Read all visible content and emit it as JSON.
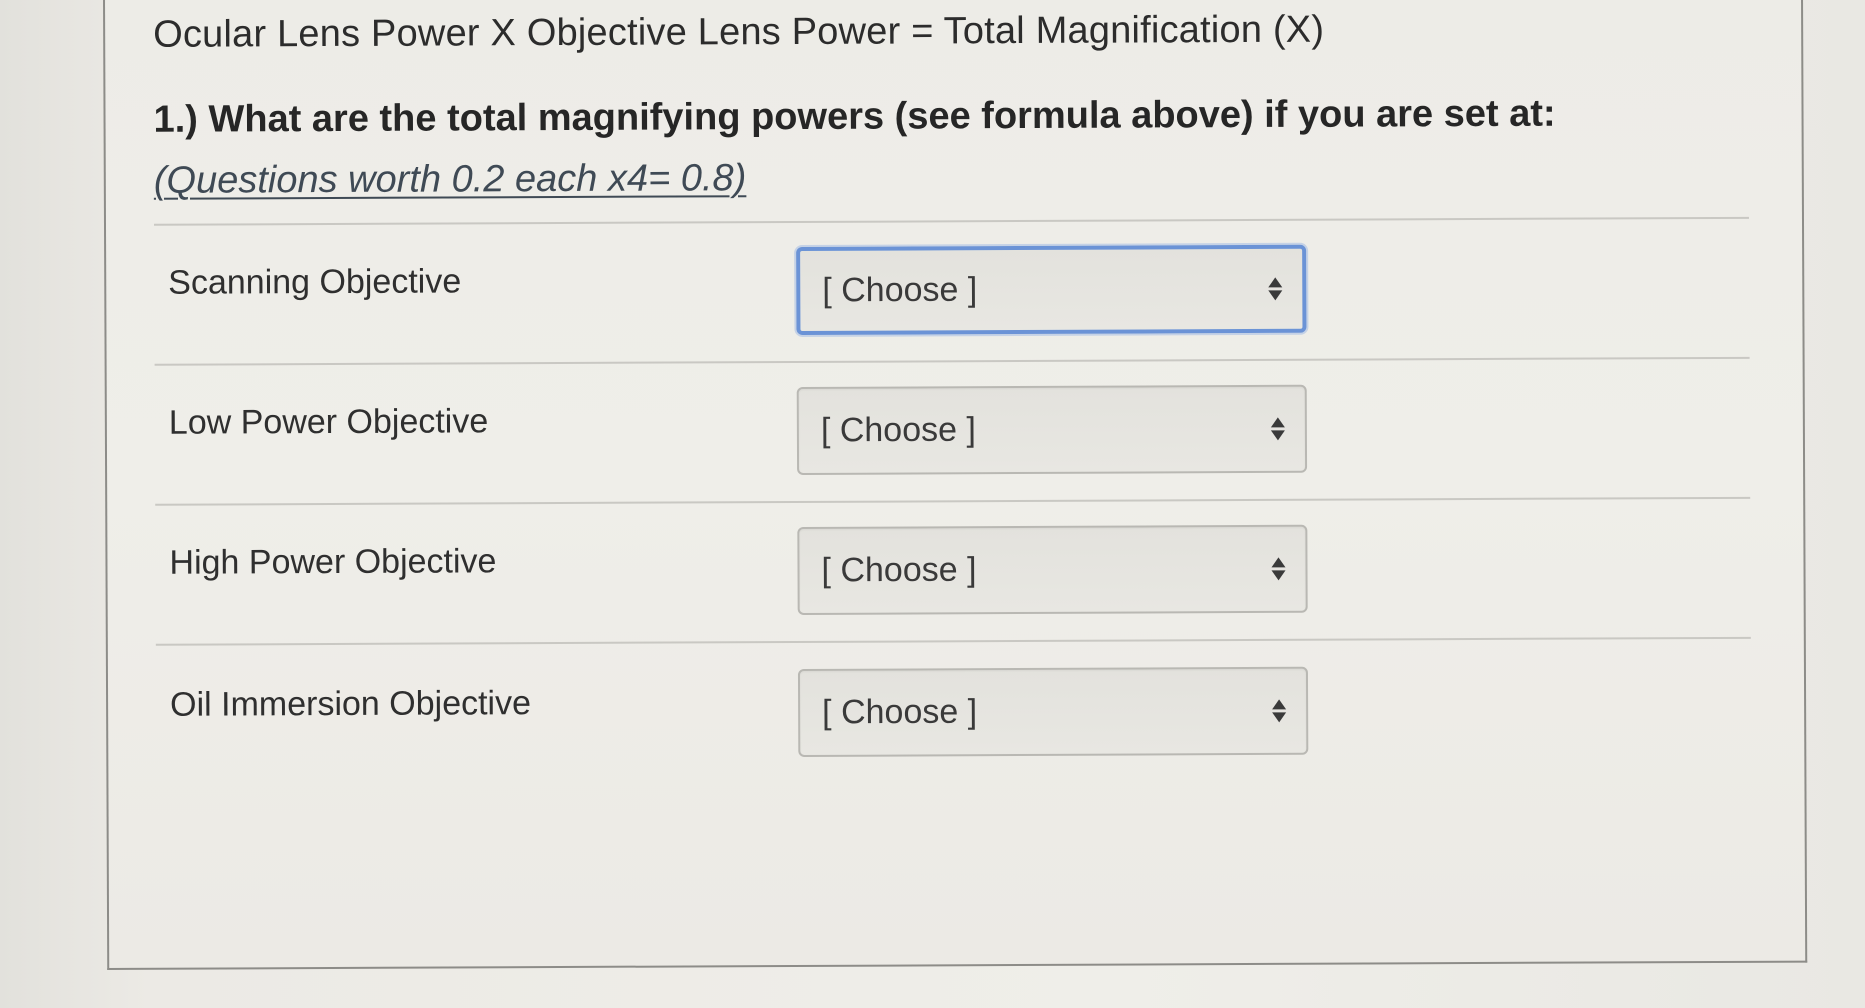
{
  "header": {
    "formula": "Ocular Lens Power X Objective Lens Power = Total Magnification (X)"
  },
  "question": {
    "text": "1.) What are the total magnifying powers (see formula above) if you are set at: ",
    "worth": "(Questions worth 0.2 each x4= 0.8)"
  },
  "rows": [
    {
      "label": "Scanning Objective",
      "select_value": "[ Choose ]",
      "focused": true
    },
    {
      "label": "Low Power Objective",
      "select_value": "[ Choose ]",
      "focused": false
    },
    {
      "label": "High Power Objective",
      "select_value": "[ Choose ]",
      "focused": false
    },
    {
      "label": "Oil Immersion Objective",
      "select_value": "[ Choose ]",
      "focused": false
    }
  ],
  "colors": {
    "focus_ring": "#6b93d6",
    "text": "#2c2c2c",
    "link": "#3f4a55"
  },
  "icons": {
    "select_arrows": "up-down-arrows-icon"
  }
}
